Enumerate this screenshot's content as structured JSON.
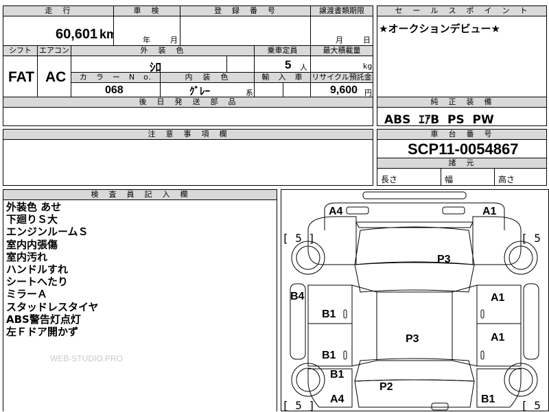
{
  "top": {
    "mileage_header": "走　行",
    "mileage_value": "60,601",
    "mileage_unit": "km",
    "inspection_header": "車　検",
    "inspection_year_unit": "年",
    "inspection_month_unit": "月",
    "registration_header": "登　録　番　号",
    "transfer_header": "譲渡書類期限",
    "transfer_month_unit": "月",
    "transfer_day_unit": "日",
    "shift_header": "シフト",
    "shift_value": "FAT",
    "aircon_header": "エアコン",
    "aircon_value": "AC",
    "exterior_color_header": "外　装　色",
    "exterior_color_value": "ｼﾛ",
    "capacity_header": "乗車定員",
    "capacity_value": "5",
    "capacity_unit": "人",
    "max_load_header": "最大積載量",
    "max_load_unit": "kg",
    "color_no_header": "カ　ラ　ー　N　o.",
    "color_no_value": "068",
    "interior_color_header": "内　装　色",
    "interior_color_value": "ｸﾞﾚｰ",
    "interior_color_suffix": "系",
    "import_header": "輸　入　車",
    "recycle_header": "リサイクル預託金",
    "recycle_value": "9,600",
    "recycle_unit": "円",
    "parts_later_header": "後　日　発　送　部　品"
  },
  "sales": {
    "header": "セ　ー　ル　ス　ポ　イ　ン　ト",
    "text": "★オークションデビュー★",
    "equipment_header": "純　正　装　備",
    "equipment_value": "ABS  ｴｱB  PS  PW"
  },
  "notes": {
    "header": "注　意　事　項　欄"
  },
  "chassis": {
    "header": "車　台　番　号",
    "value": "SCP11-0054867",
    "specs_header": "諸　元",
    "length_label": "長さ",
    "width_label": "幅",
    "height_label": "高さ"
  },
  "inspector": {
    "header": "検　査　員　記　入　欄",
    "remarks": [
      "外装色 あせ",
      "下廻りＳ大",
      "エンジンルームＳ",
      "室内内張傷",
      "室内汚れ",
      "ハンドルすれ",
      "シートへたり",
      "ミラーＡ",
      "スタッドレスタイヤ",
      "ABS警告灯点灯",
      "左Ｆドア開かず"
    ],
    "watermark": "WEB-STUDIO.PRO"
  },
  "diagram": {
    "labels": {
      "a4_top": "A4",
      "a1_top": "A1",
      "tire_fl": "[ 5 ]",
      "tire_fr": "[ 5 ]",
      "tire_rl": "[ 5 ]",
      "tire_rr": "[ 5 ]",
      "p3_top": "P3",
      "b4_left": "B4",
      "a1_right_front": "A1",
      "b1_left_front": "B1",
      "p3_mid": "P3",
      "a1_right_rear": "A1",
      "b1_left_rear": "B1",
      "b1_left_lower": "B1",
      "p2": "P2",
      "a4_bottom": "A4",
      "b1_bottom_right": "B1"
    }
  }
}
